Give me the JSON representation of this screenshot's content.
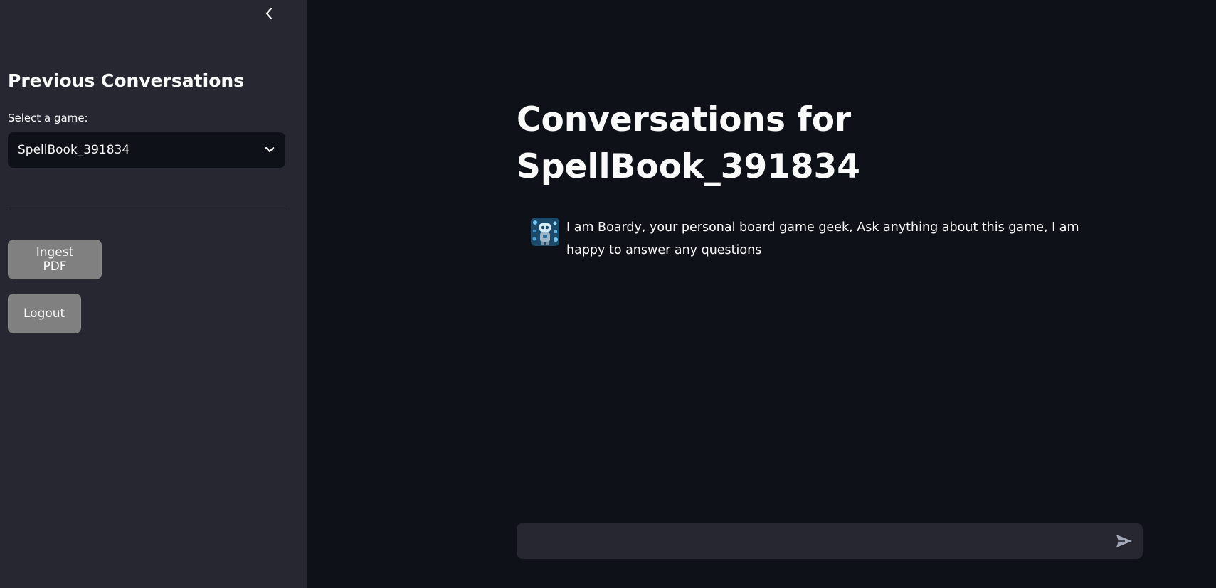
{
  "sidebar": {
    "collapse_icon": "chevron-left-icon",
    "title": "Previous Conversations",
    "select": {
      "label": "Select a game:",
      "value": "SpellBook_391834",
      "icon": "chevron-down-icon"
    },
    "buttons": {
      "ingest_label": "Ingest PDF",
      "logout_label": "Logout"
    },
    "colors": {
      "background": "#262730",
      "button": "#808080"
    }
  },
  "main": {
    "title_line1": "Conversations for",
    "title_line2": "SpellBook_391834",
    "messages": [
      {
        "role": "assistant",
        "avatar": "robot-avatar",
        "text": "I am Boardy, your personal board game geek, Ask anything about this game, I am happy to answer any questions"
      }
    ],
    "chat_input": {
      "placeholder": "",
      "send_icon": "send-icon"
    },
    "colors": {
      "background": "#0e1117",
      "input_background": "#262730"
    }
  }
}
